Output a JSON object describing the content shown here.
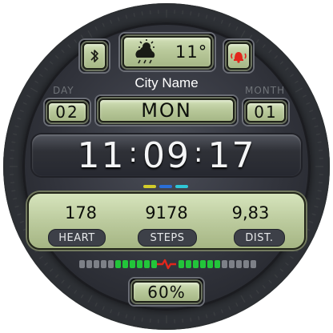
{
  "status": {
    "bluetooth_icon": "bluetooth-icon",
    "weather_icon": "partly-cloudy-rain-icon",
    "temperature": "11°",
    "alarm_icon": "alarm-icon",
    "alarm_color": "#e2261c"
  },
  "city": "City Name",
  "date": {
    "day_label": "DAY",
    "day_value": "02",
    "weekday": "MON",
    "month_label": "MONTH",
    "month_value": "01"
  },
  "time": {
    "hours": "11",
    "minutes": "09",
    "seconds": "17"
  },
  "metrics": [
    {
      "value": "178",
      "label": "HEART"
    },
    {
      "value": "9178",
      "label": "STEPS"
    },
    {
      "value": "9,83",
      "label": "DIST."
    }
  ],
  "battery": {
    "percent_text": "60%",
    "level": 0.6
  },
  "colors": {
    "lcd": "#c3d2a6",
    "led_on": "#22c53a",
    "led_off": "#7d8087",
    "accent_red": "#e2261c"
  }
}
